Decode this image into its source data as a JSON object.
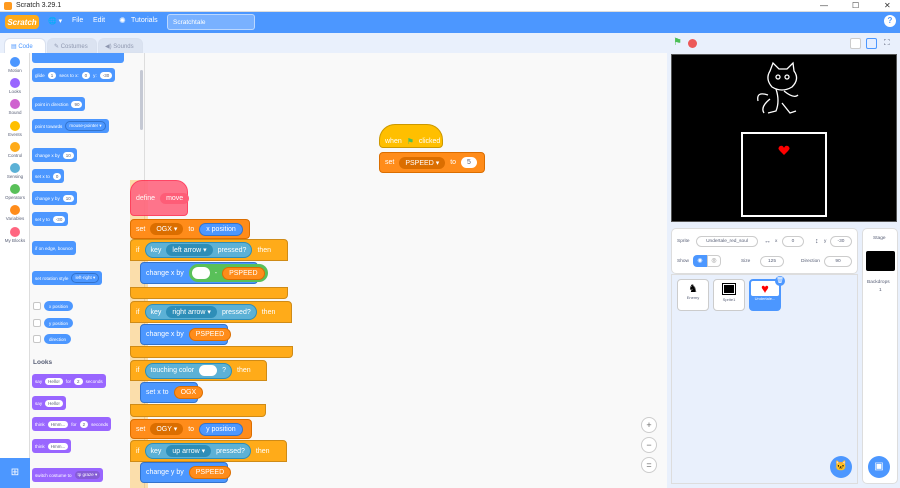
{
  "window": {
    "title": "Scratch 3.29.1",
    "min": "—",
    "max": "☐",
    "close": "✕"
  },
  "menu": {
    "logo": "Scratch",
    "globe": "🌐 ▾",
    "file": "File",
    "edit": "Edit",
    "tutorials": "Tutorials",
    "project_name": "Scratchtale",
    "help": "?"
  },
  "tabs": {
    "code": "Code",
    "costumes": "Costumes",
    "sounds": "Sounds"
  },
  "categories": [
    {
      "label": "Motion",
      "color": "#4c97ff"
    },
    {
      "label": "Looks",
      "color": "#9966ff"
    },
    {
      "label": "Sound",
      "color": "#cf63cf"
    },
    {
      "label": "Events",
      "color": "#ffbf00"
    },
    {
      "label": "Control",
      "color": "#ffab19"
    },
    {
      "label": "Sensing",
      "color": "#5cb1d6"
    },
    {
      "label": "Operators",
      "color": "#59c059"
    },
    {
      "label": "Variables",
      "color": "#ff8c1a"
    },
    {
      "label": "My Blocks",
      "color": "#ff6680"
    }
  ],
  "palette": {
    "glide_a": "glide",
    "glide_secs": "1",
    "glide_b": "secs to x:",
    "glide_x": "0",
    "glide_c": "y:",
    "glide_y": "-30",
    "point_dir": "point in direction",
    "point_dir_val": "90",
    "point_towards": "point towards",
    "point_towards_val": "mouse-pointer ▾",
    "change_x": "change x by",
    "change_x_val": "10",
    "set_x": "set x to",
    "set_x_val": "0",
    "change_y": "change y by",
    "change_y_val": "10",
    "set_y": "set y to",
    "set_y_val": "-30",
    "bounce": "if on edge, bounce",
    "rot_style": "set rotation style",
    "rot_style_val": "left-right ▾",
    "rep_x": "x position",
    "rep_y": "y position",
    "rep_dir": "direction",
    "looks_heading": "Looks",
    "say_secs_a": "say",
    "say_secs_msg": "Hello!",
    "say_secs_b": "for",
    "say_secs_n": "2",
    "say_secs_c": "seconds",
    "say_a": "say",
    "say_msg": "Hello!",
    "think_secs_a": "think",
    "think_secs_msg": "Hmm...",
    "think_secs_b": "for",
    "think_secs_n": "2",
    "think_secs_c": "seconds",
    "think_a": "think",
    "think_msg": "Hmm...",
    "costume": "switch costume to",
    "costume_val": "tp graze ▾"
  },
  "script1": {
    "when": "when",
    "clicked": "clicked",
    "set": "set",
    "var": "PSPEED ▾",
    "to": "to",
    "val": "5"
  },
  "script2": {
    "define": "define",
    "move": "move",
    "set1": "set",
    "ogx": "OGX ▾",
    "to1": "to",
    "xpos": "x position",
    "if1": "if",
    "key1": "key",
    "left": "left arrow ▾",
    "pressed1": "pressed?",
    "then1": "then",
    "chx1": "change x by",
    "minus": "-",
    "psp1": "PSPEED",
    "if2": "if",
    "key2": "key",
    "right": "right arrow ▾",
    "pressed2": "pressed?",
    "then2": "then",
    "chx2": "change x by",
    "psp2": "PSPEED",
    "if3": "if",
    "touching": "touching color",
    "q": "?",
    "then3": "then",
    "setx": "set x to",
    "ogx_r": "OGX",
    "set2": "set",
    "ogy": "OGY ▾",
    "to2": "to",
    "ypos": "y position",
    "if4": "if",
    "key3": "key",
    "up": "up arrow ▾",
    "pressed3": "pressed?",
    "then4": "then",
    "chy": "change y by",
    "psp3": "PSPEED"
  },
  "zoom": {
    "in": "+",
    "out": "−",
    "reset": "="
  },
  "sprite": {
    "label": "Sprite",
    "name": "Undertale_red_soul",
    "x_label": "x",
    "x": "0",
    "y_label": "y",
    "y": "-30",
    "show": "Show",
    "size_label": "Size",
    "size": "125",
    "dir_label": "Direction",
    "dir": "90"
  },
  "sprites": [
    {
      "name": "Enemy"
    },
    {
      "name": "Sprite1"
    },
    {
      "name": "Undertale..."
    }
  ],
  "stage_panel": {
    "title": "Stage",
    "backdrops": "Backdrops",
    "count": "1"
  }
}
